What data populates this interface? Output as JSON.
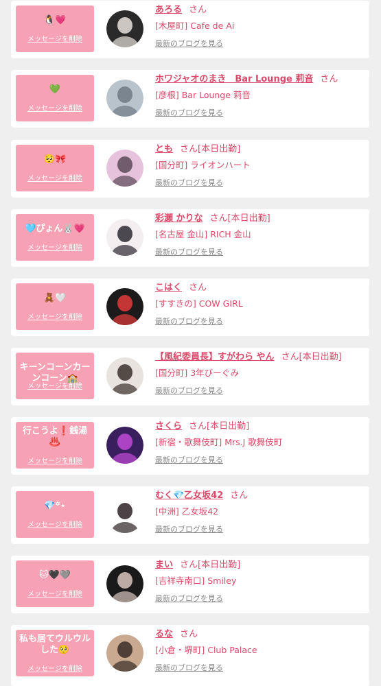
{
  "items": [
    {
      "message": "🐧💗",
      "delete_label": "メッセージを削除",
      "name": "あろる",
      "honorific": "さん",
      "status": "",
      "location": "[木屋町] Cafe de Ai",
      "blog_label": "最新のブログを見る",
      "avatar_colors": [
        "#2a2a2a",
        "#e8e2dc"
      ]
    },
    {
      "message": "💚",
      "delete_label": "メッセージを削除",
      "name": "ホワジャオのまき　Bar Lounge 莉音",
      "honorific": "さん",
      "status": "",
      "location": "[彦根] Bar Lounge 莉音",
      "blog_label": "最新のブログを見る",
      "avatar_colors": [
        "#b9c3cc",
        "#6f7a84"
      ]
    },
    {
      "message": "🥺🎀",
      "delete_label": "メッセージを削除",
      "name": "とも",
      "honorific": "さん",
      "status": "[本日出勤]",
      "location": "[国分町] ライオンハート",
      "blog_label": "最新のブログを見る",
      "avatar_colors": [
        "#e7c2dc",
        "#5a4a58"
      ]
    },
    {
      "message": "🩵ぴょん🐰💗",
      "delete_label": "メッセージを削除",
      "name": "彩瀬 かりな",
      "honorific": "さん",
      "status": "[本日出勤]",
      "location": "[名古屋 金山] RICH 金山",
      "blog_label": "最新のブログを見る",
      "avatar_colors": [
        "#f4eef0",
        "#2d2a33"
      ]
    },
    {
      "message": "🧸🤍",
      "delete_label": "メッセージを削除",
      "name": "こはく",
      "honorific": "さん",
      "status": "",
      "location": "[すすきの] COW GIRL",
      "blog_label": "最新のブログを見る",
      "avatar_colors": [
        "#1c1a1a",
        "#e23b3b"
      ]
    },
    {
      "message": "キーンコーンカーンコーン🏫",
      "delete_label": "メッセージを削除",
      "name": "【風紀委員長】すがわら やん",
      "honorific": "さん",
      "status": "[本日出勤]",
      "location": "[国分町] 3年びーぐみ",
      "blog_label": "最新のブログを見る",
      "avatar_colors": [
        "#e9e3df",
        "#3a302c"
      ]
    },
    {
      "message": "行こうよ❗️銭湯♨️",
      "delete_label": "メッセージを削除",
      "name": "さくら",
      "honorific": "さん",
      "status": "[本日出勤]",
      "location": "[新宿・歌舞伎町] Mrs.J 歌舞伎町",
      "blog_label": "最新のブログを見る",
      "avatar_colors": [
        "#3a1f5e",
        "#c04ad6"
      ]
    },
    {
      "message": "💎꙳⋆",
      "delete_label": "メッセージを削除",
      "name": "むく💎乙女坂42",
      "honorific": "さん",
      "status": "",
      "location": "[中洲] 乙女坂42",
      "blog_label": "最新のブログを見る",
      "avatar_colors": [
        "#ffffff",
        "#2b2224"
      ]
    },
    {
      "message": "🐱🖤🩶",
      "delete_label": "メッセージを削除",
      "name": "まい",
      "honorific": "さん",
      "status": "[本日出勤]",
      "location": "[吉祥寺南口] Smiley",
      "blog_label": "最新のブログを見る",
      "avatar_colors": [
        "#1a1a1a",
        "#d8c6bd"
      ]
    },
    {
      "message": "私も居てウルウルした🥺",
      "delete_label": "メッセージを削除",
      "name": "るな",
      "honorific": "さん",
      "status": "",
      "location": "[小倉・堺町] Club Palace",
      "blog_label": "最新のブログを見る",
      "avatar_colors": [
        "#c9a98f",
        "#3b2d27"
      ]
    }
  ]
}
